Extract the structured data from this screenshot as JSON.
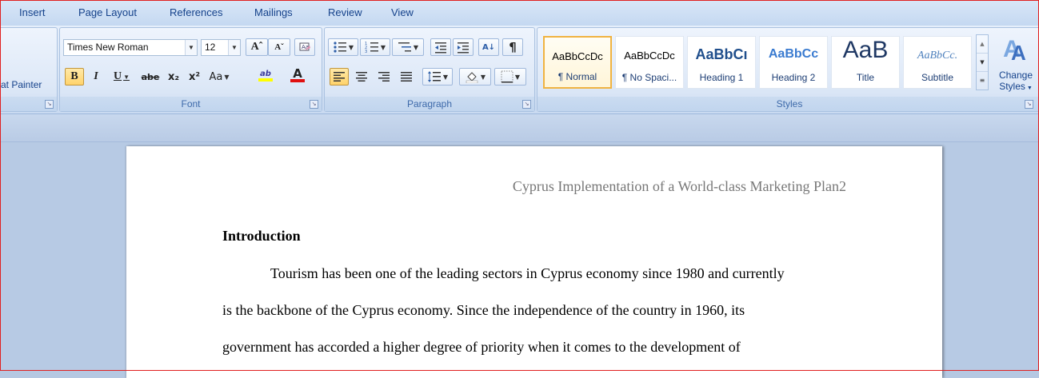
{
  "tabs": [
    "Insert",
    "Page Layout",
    "References",
    "Mailings",
    "Review",
    "View"
  ],
  "clipboard": {
    "format_painter_label": "at Painter"
  },
  "font": {
    "family": "Times New Roman",
    "size": "12",
    "group_label": "Font",
    "bold": "B",
    "italic": "I",
    "underline": "U",
    "strikethrough": "abe",
    "subscript": "x₂",
    "superscript": "x²",
    "change_case": "Aa",
    "grow": "Aˆ",
    "shrink": "Aˇ",
    "highlight": "ab",
    "font_color": "A"
  },
  "paragraph": {
    "group_label": "Paragraph",
    "sort": "A↓",
    "show_marks": "¶"
  },
  "styles": {
    "group_label": "Styles",
    "tiles": [
      {
        "sample": "AaBbCcDc",
        "name": "¶ Normal"
      },
      {
        "sample": "AaBbCcDc",
        "name": "¶ No Spaci..."
      },
      {
        "sample": "AaBbCı",
        "name": "Heading 1"
      },
      {
        "sample": "AaBbCc",
        "name": "Heading 2"
      },
      {
        "sample": "AaB",
        "name": "Title"
      },
      {
        "sample": "AaBbCc.",
        "name": "Subtitle"
      }
    ],
    "change_styles_line1": "Change",
    "change_styles_line2": "Styles"
  },
  "document": {
    "header": "Cyprus Implementation of a World-class Marketing Plan2",
    "heading": "Introduction",
    "lines": [
      "Tourism has been one of the leading sectors in Cyprus economy since 1980 and currently",
      "is the backbone of the Cyprus economy. Since the independence of the country in 1960, its",
      "government has accorded a higher degree of priority when it comes to the development of"
    ]
  },
  "colors": {
    "accent_text": "#15428b",
    "selection_gold": "#f0b341",
    "font_color_bar": "#e01010",
    "highlight_bar": "#ffff00"
  }
}
